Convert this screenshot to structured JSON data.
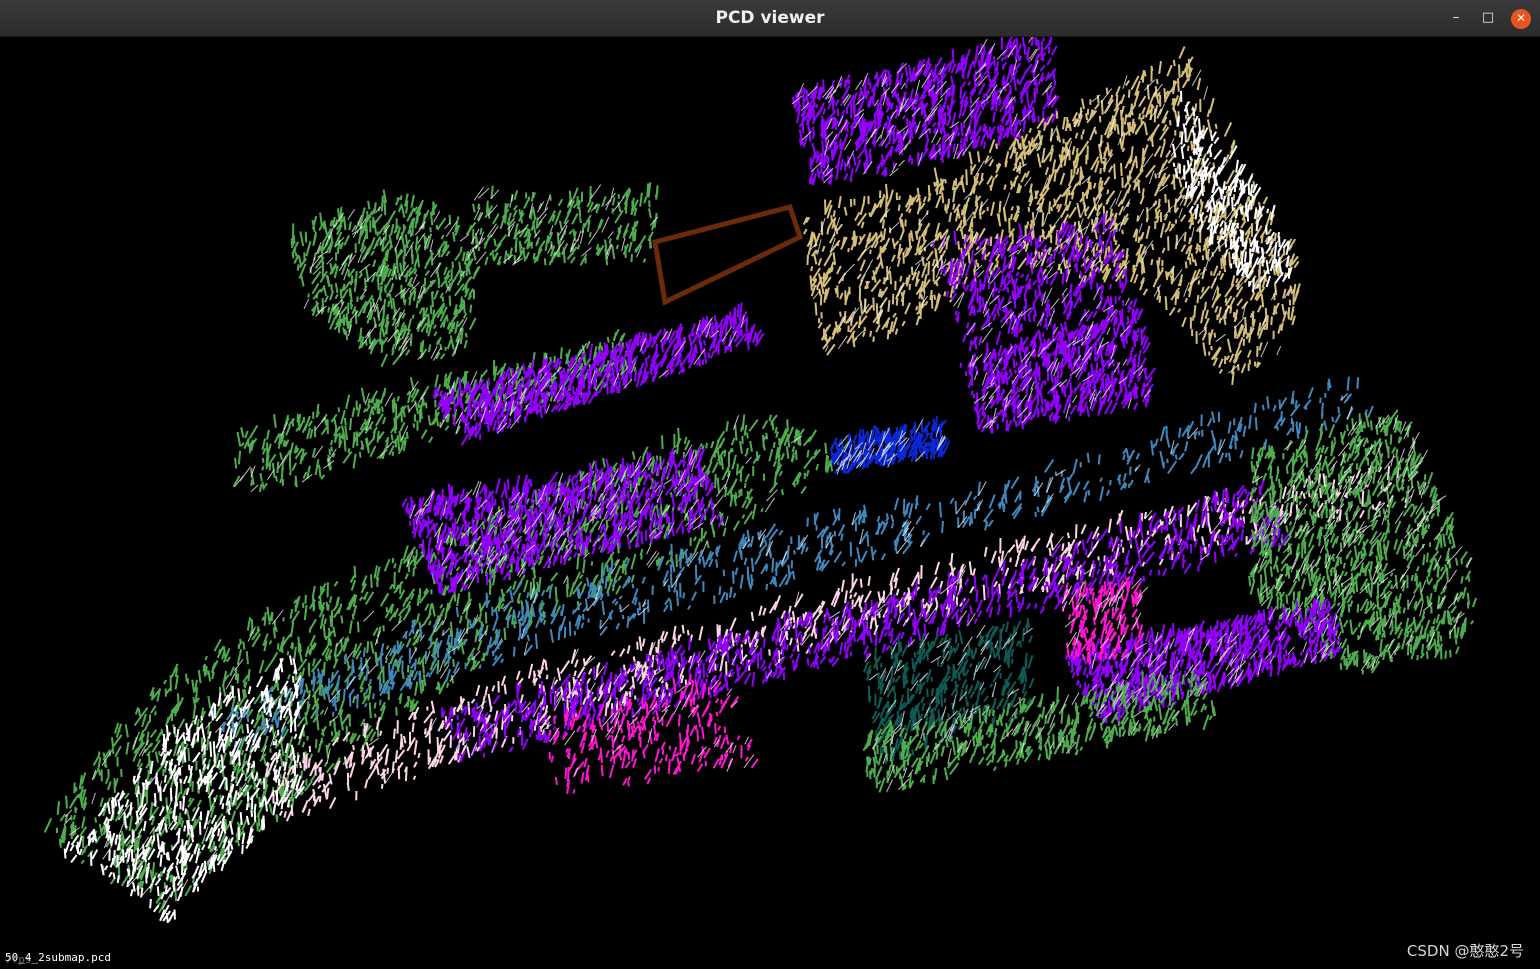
{
  "window": {
    "title": "PCD viewer",
    "controls": {
      "minimize_glyph": "–",
      "maximize_glyph": "□",
      "close_glyph": "✕"
    }
  },
  "viewer": {
    "loaded_file": "50_4_2submap.pcd",
    "fps_text": "7fps"
  },
  "watermark": "CSDN @憨憨2号",
  "colors": {
    "background": "#000000",
    "green": "#4fad4f",
    "purple": "#9400ff",
    "tan": "#d4be78",
    "steel_blue": "#3f88bb",
    "pink": "#ffd6e8",
    "magenta": "#ff14d2",
    "blue": "#0a28d6",
    "white": "#ffffff",
    "brown": "#6b2a0a",
    "dark_teal": "#0f5a55",
    "close_button": "#e95420"
  }
}
